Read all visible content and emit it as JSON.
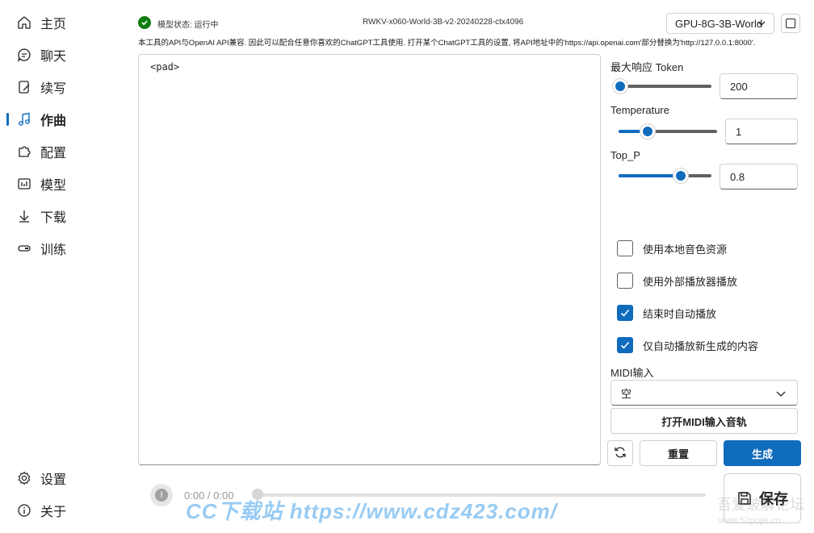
{
  "sidebar": {
    "items": [
      {
        "label": "主页",
        "icon": "home-icon"
      },
      {
        "label": "聊天",
        "icon": "chat-icon"
      },
      {
        "label": "续写",
        "icon": "edit-icon"
      },
      {
        "label": "作曲",
        "icon": "music-note-icon",
        "active": true
      },
      {
        "label": "配置",
        "icon": "puzzle-icon"
      },
      {
        "label": "模型",
        "icon": "model-icon"
      },
      {
        "label": "下载",
        "icon": "download-icon"
      },
      {
        "label": "训练",
        "icon": "train-icon"
      }
    ],
    "bottom_items": [
      {
        "label": "设置",
        "icon": "gear-icon"
      },
      {
        "label": "关于",
        "icon": "info-icon"
      }
    ]
  },
  "topbar": {
    "status": "模型状态: 运行中",
    "model_name": "RWKV-x060-World-3B-v2-20240228-ctx4096",
    "gpu_config": "GPU-8G-3B-World",
    "note": "本工具的API与OpenAI API兼容. 因此可以配合任意你喜欢的ChatGPT工具使用. 打开某个ChatGPT工具的设置, 将API地址中的'https://api.openai.com'部分替换为'http://127.0.0.1:8000'."
  },
  "prompt": {
    "value": "<pad>"
  },
  "params": {
    "max_tokens": {
      "label": "最大响应 Token",
      "value": "200",
      "fraction": 0.0
    },
    "temperature": {
      "label": "Temperature",
      "value": "1",
      "fraction": 0.33
    },
    "top_p": {
      "label": "Top_P",
      "value": "0.8",
      "fraction": 0.8
    }
  },
  "options": [
    {
      "label": "使用本地音色资源",
      "checked": false
    },
    {
      "label": "使用外部播放器播放",
      "checked": false
    },
    {
      "label": "结束时自动播放",
      "checked": true
    },
    {
      "label": "仅自动播放新生成的内容",
      "checked": true
    }
  ],
  "midi": {
    "label": "MIDI输入",
    "selected": "空",
    "open_track_label": "打开MIDI输入音轨"
  },
  "actions": {
    "reset_label": "重置",
    "generate_label": "生成",
    "save_label": "保存"
  },
  "player": {
    "time": "0:00 / 0:00",
    "progress": 0
  },
  "watermark": {
    "main": "CC下载站 https://www.cdz423.com/",
    "corner": "吾爱破解论坛",
    "corner_url": "www.52pojie.cn"
  },
  "colors": {
    "accent": "#0f6cbd",
    "status_ok": "#107c10"
  }
}
